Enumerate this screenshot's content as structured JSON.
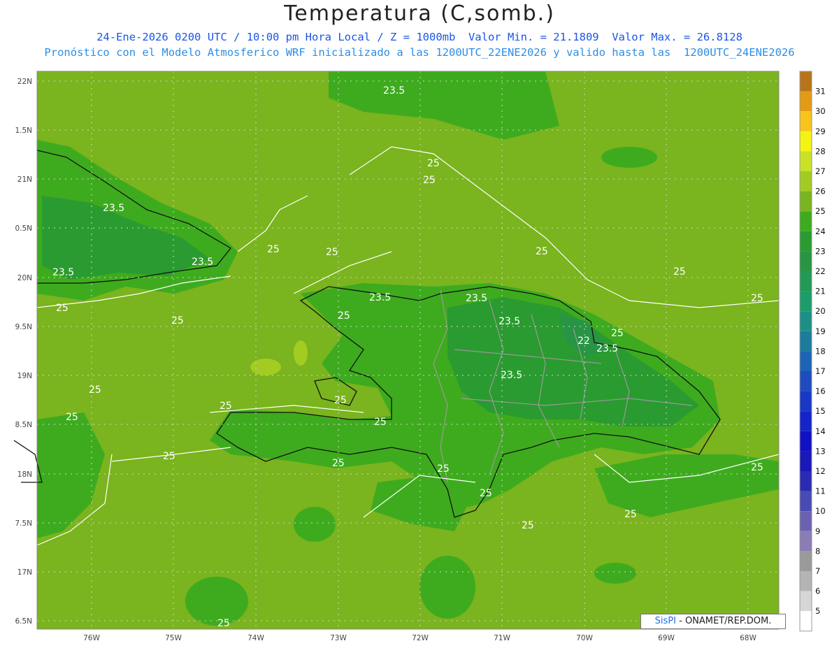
{
  "header": {
    "title": "Temperatura (C,somb.)",
    "line1": "24-Ene-2026 0200 UTC / 10:00 pm Hora Local / Z = 1000mb  Valor Min. = 21.1809  Valor Max. = 26.8128",
    "line2": "Pronóstico con el Modelo Atmosferico WRF inicializado a las 1200UTC_22ENE2026 y valido hasta las  1200UTC_24ENE2026"
  },
  "axes": {
    "lat_labels": [
      "22N",
      "1.5N",
      "21N",
      "0.5N",
      "20N",
      "9.5N",
      "19N",
      "8.5N",
      "18N",
      "7.5N",
      "17N",
      "6.5N"
    ],
    "lon_labels": [
      "76W",
      "75W",
      "74W",
      "73W",
      "72W",
      "71W",
      "70W",
      "69W",
      "68W"
    ]
  },
  "colorbar": {
    "labels": [
      "31",
      "30",
      "29",
      "28",
      "27",
      "26",
      "25",
      "24",
      "23",
      "22",
      "21",
      "20",
      "19",
      "18",
      "17",
      "16",
      "15",
      "14",
      "13",
      "12",
      "11",
      "10",
      "9",
      "8",
      "7",
      "6",
      "5"
    ],
    "colors": [
      "#b8741a",
      "#e39a14",
      "#f6c41c",
      "#f4f412",
      "#c9e227",
      "#a3cc22",
      "#7ab41e",
      "#3eab1e",
      "#2a9b30",
      "#289445",
      "#229a55",
      "#1f9c6c",
      "#1d8f87",
      "#1d7b9c",
      "#1d64b4",
      "#1e4cbe",
      "#1a38c6",
      "#1424ca",
      "#1010c4",
      "#1a18b8",
      "#2a2ab2",
      "#4a4ab4",
      "#6a62b0",
      "#8a7cb4",
      "#9a9a9a",
      "#b4b4b4",
      "#d6d6d6",
      "#ffffff"
    ]
  },
  "contour_labels": [
    "23.5",
    "25",
    "25",
    "23.5",
    "23.5",
    "25",
    "25",
    "25",
    "25",
    "23.5",
    "23.5",
    "25",
    "23.5",
    "25",
    "22",
    "23.5",
    "25",
    "23.5",
    "25",
    "25",
    "25",
    "25",
    "23.5",
    "25",
    "25",
    "25",
    "25",
    "25",
    "25",
    "25",
    "25",
    "25",
    "25",
    "25"
  ],
  "logo": {
    "brand": "SisPI",
    "text": " - ONAMET/REP.DOM."
  }
}
